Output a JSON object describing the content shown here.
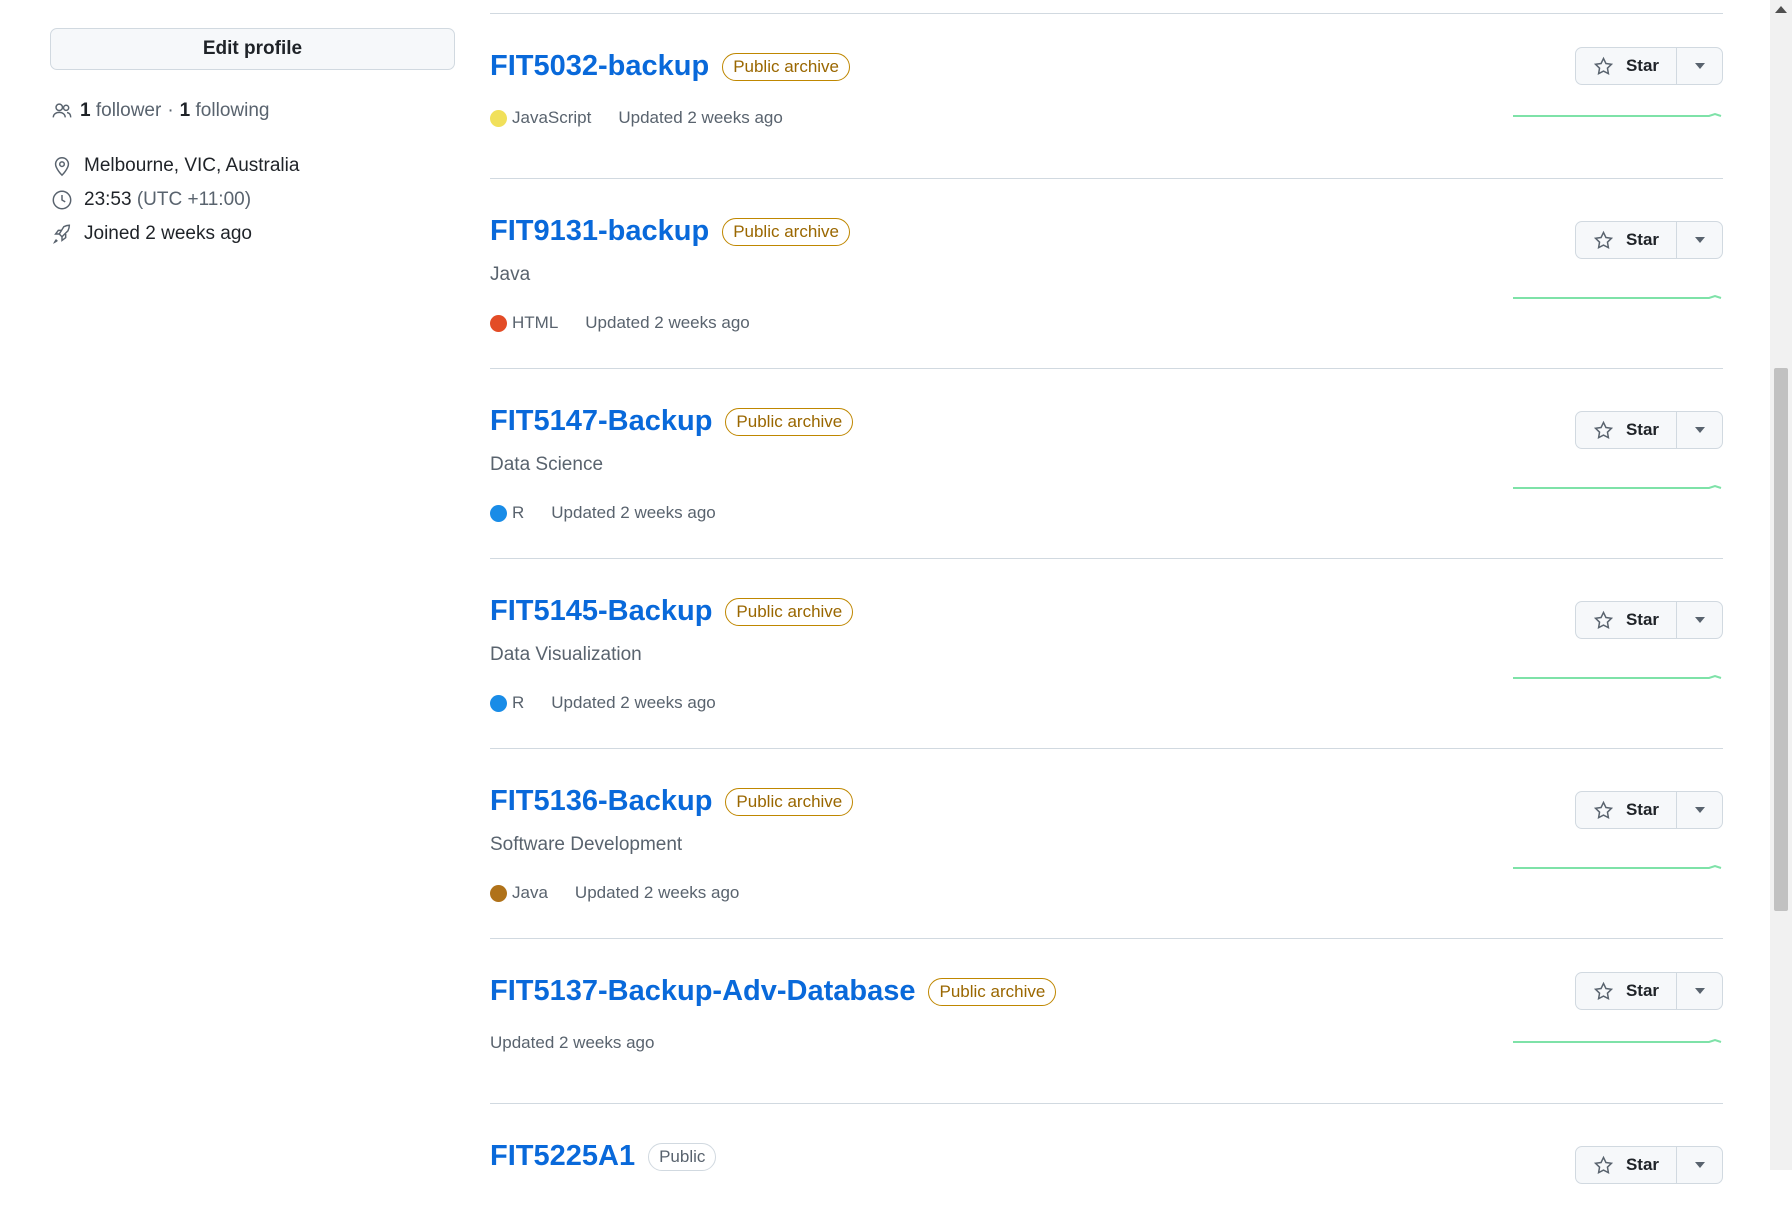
{
  "sidebar": {
    "edit_profile_label": "Edit profile",
    "followers_count": "1",
    "followers_label": "follower",
    "separator": "·",
    "following_count": "1",
    "following_label": "following",
    "location": "Melbourne, VIC, Australia",
    "local_time": "23:53",
    "timezone": "(UTC +11:00)",
    "joined": "Joined 2 weeks ago"
  },
  "repos": [
    {
      "name": "FIT5032-backup",
      "badge": "Public archive",
      "description": "",
      "language": "JavaScript",
      "language_color": "#f1e05a",
      "updated": "Updated 2 weeks ago",
      "star_label": "Star"
    },
    {
      "name": "FIT9131-backup",
      "badge": "Public archive",
      "description": "Java",
      "language": "HTML",
      "language_color": "#e34c26",
      "updated": "Updated 2 weeks ago",
      "star_label": "Star"
    },
    {
      "name": "FIT5147-Backup",
      "badge": "Public archive",
      "description": "Data Science",
      "language": "R",
      "language_color": "#198ce7",
      "updated": "Updated 2 weeks ago",
      "star_label": "Star"
    },
    {
      "name": "FIT5145-Backup",
      "badge": "Public archive",
      "description": "Data Visualization",
      "language": "R",
      "language_color": "#198ce7",
      "updated": "Updated 2 weeks ago",
      "star_label": "Star"
    },
    {
      "name": "FIT5136-Backup",
      "badge": "Public archive",
      "description": "Software Development",
      "language": "Java",
      "language_color": "#b07219",
      "updated": "Updated 2 weeks ago",
      "star_label": "Star"
    },
    {
      "name": "FIT5137-Backup-Adv-Database",
      "badge": "Public archive",
      "description": "",
      "language": "",
      "language_color": "",
      "updated": "Updated 2 weeks ago",
      "star_label": "Star"
    },
    {
      "name": "FIT5225A1",
      "badge": "Public",
      "description": "",
      "language": "",
      "language_color": "",
      "updated": "",
      "star_label": "Star"
    }
  ],
  "colors": {
    "link": "#0969da",
    "archive_badge": "#9a6700",
    "sparkline": "#7ee2a8"
  }
}
